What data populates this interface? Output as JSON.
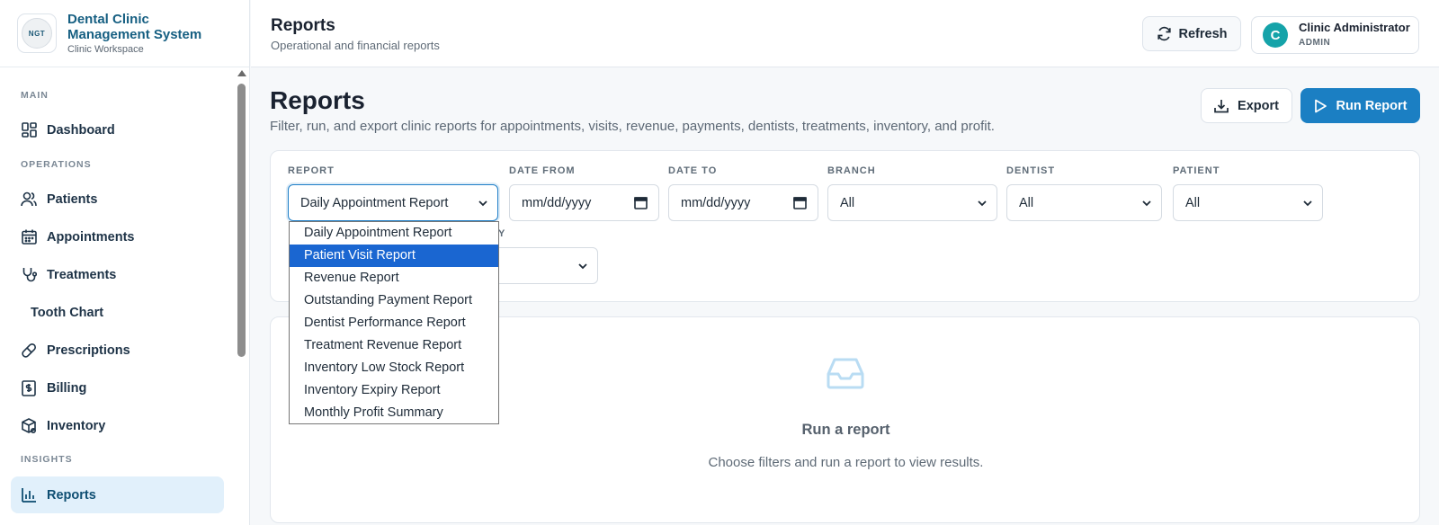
{
  "brand": {
    "logo_text": "NGT",
    "title_line1": "Dental Clinic",
    "title_line2": "Management System",
    "subtitle": "Clinic Workspace"
  },
  "sidebar": {
    "sections": [
      {
        "label": "MAIN"
      },
      {
        "label": "OPERATIONS"
      },
      {
        "label": "INSIGHTS"
      }
    ],
    "items": [
      {
        "label": "Dashboard",
        "icon": "grid-icon"
      },
      {
        "label": "Patients",
        "icon": "users-icon"
      },
      {
        "label": "Appointments",
        "icon": "calendar-icon"
      },
      {
        "label": "Treatments",
        "icon": "stethoscope-icon"
      },
      {
        "label": "Tooth Chart",
        "icon": ""
      },
      {
        "label": "Prescriptions",
        "icon": "pill-icon"
      },
      {
        "label": "Billing",
        "icon": "receipt-icon"
      },
      {
        "label": "Inventory",
        "icon": "box-icon"
      },
      {
        "label": "Reports",
        "icon": "bar-chart-icon",
        "active": true
      }
    ]
  },
  "header": {
    "title": "Reports",
    "subtitle": "Operational and financial reports",
    "refresh_label": "Refresh",
    "user_initial": "C",
    "user_name": "Clinic Administrator",
    "user_role": "ADMIN"
  },
  "page": {
    "title": "Reports",
    "description": "Filter, run, and export clinic reports for appointments, visits, revenue, payments, dentists, treatments, inventory, and profit.",
    "export_label": "Export",
    "run_label": "Run Report"
  },
  "filters": {
    "report_label": "REPORT",
    "report_value": "Daily Appointment Report",
    "date_from_label": "DATE FROM",
    "date_from_value": "mm/dd/yyyy",
    "date_to_label": "DATE TO",
    "date_to_value": "mm/dd/yyyy",
    "branch_label": "BRANCH",
    "branch_value": "All",
    "dentist_label": "DENTIST",
    "dentist_value": "All",
    "patient_label": "PATIENT",
    "patient_value": "All",
    "partial_label": "Y"
  },
  "report_options": [
    "Daily Appointment Report",
    "Patient Visit Report",
    "Revenue Report",
    "Outstanding Payment Report",
    "Dentist Performance Report",
    "Treatment Revenue Report",
    "Inventory Low Stock Report",
    "Inventory Expiry Report",
    "Monthly Profit Summary"
  ],
  "highlighted_option_index": 1,
  "empty_state": {
    "icon": "inbox-icon",
    "title": "Run a report",
    "description": "Choose filters and run a report to view results."
  },
  "colors": {
    "brand": "#165f82",
    "primary": "#1b7fc3",
    "active_nav_bg": "#e1f0fb",
    "avatar": "#15a3a9",
    "dropdown_highlight": "#1a66d1"
  }
}
